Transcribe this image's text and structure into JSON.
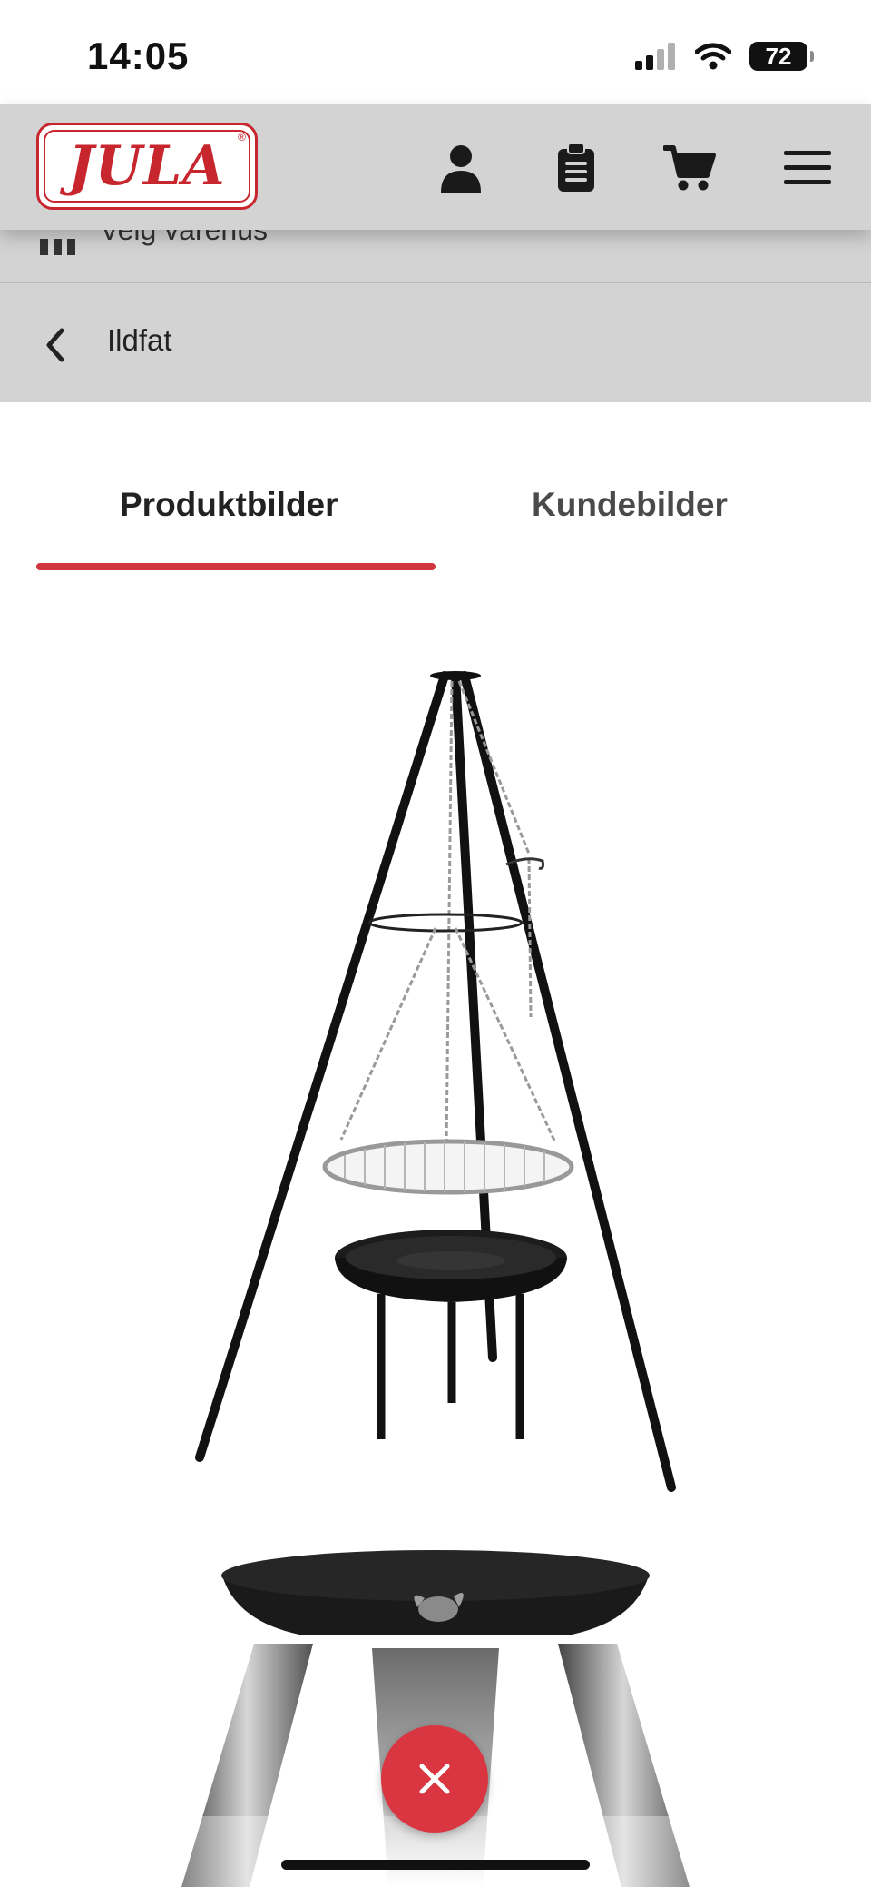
{
  "status_bar": {
    "time": "14:05",
    "battery": "72"
  },
  "header": {
    "logo_text": "JULA",
    "logo_reg": "®",
    "icons": [
      "account-icon",
      "shopping-list-icon",
      "cart-icon",
      "menu-icon"
    ]
  },
  "store_strip": {
    "label": "Velg varehus"
  },
  "breadcrumb": {
    "back_label": "Ildfat"
  },
  "tabs": [
    {
      "label": "Produktbilder",
      "active": true
    },
    {
      "label": "Kundebilder",
      "active": false
    }
  ],
  "colors": {
    "accent": "#d1363f",
    "brand_red": "#c8262e",
    "header_bg": "#d3d3d3"
  }
}
